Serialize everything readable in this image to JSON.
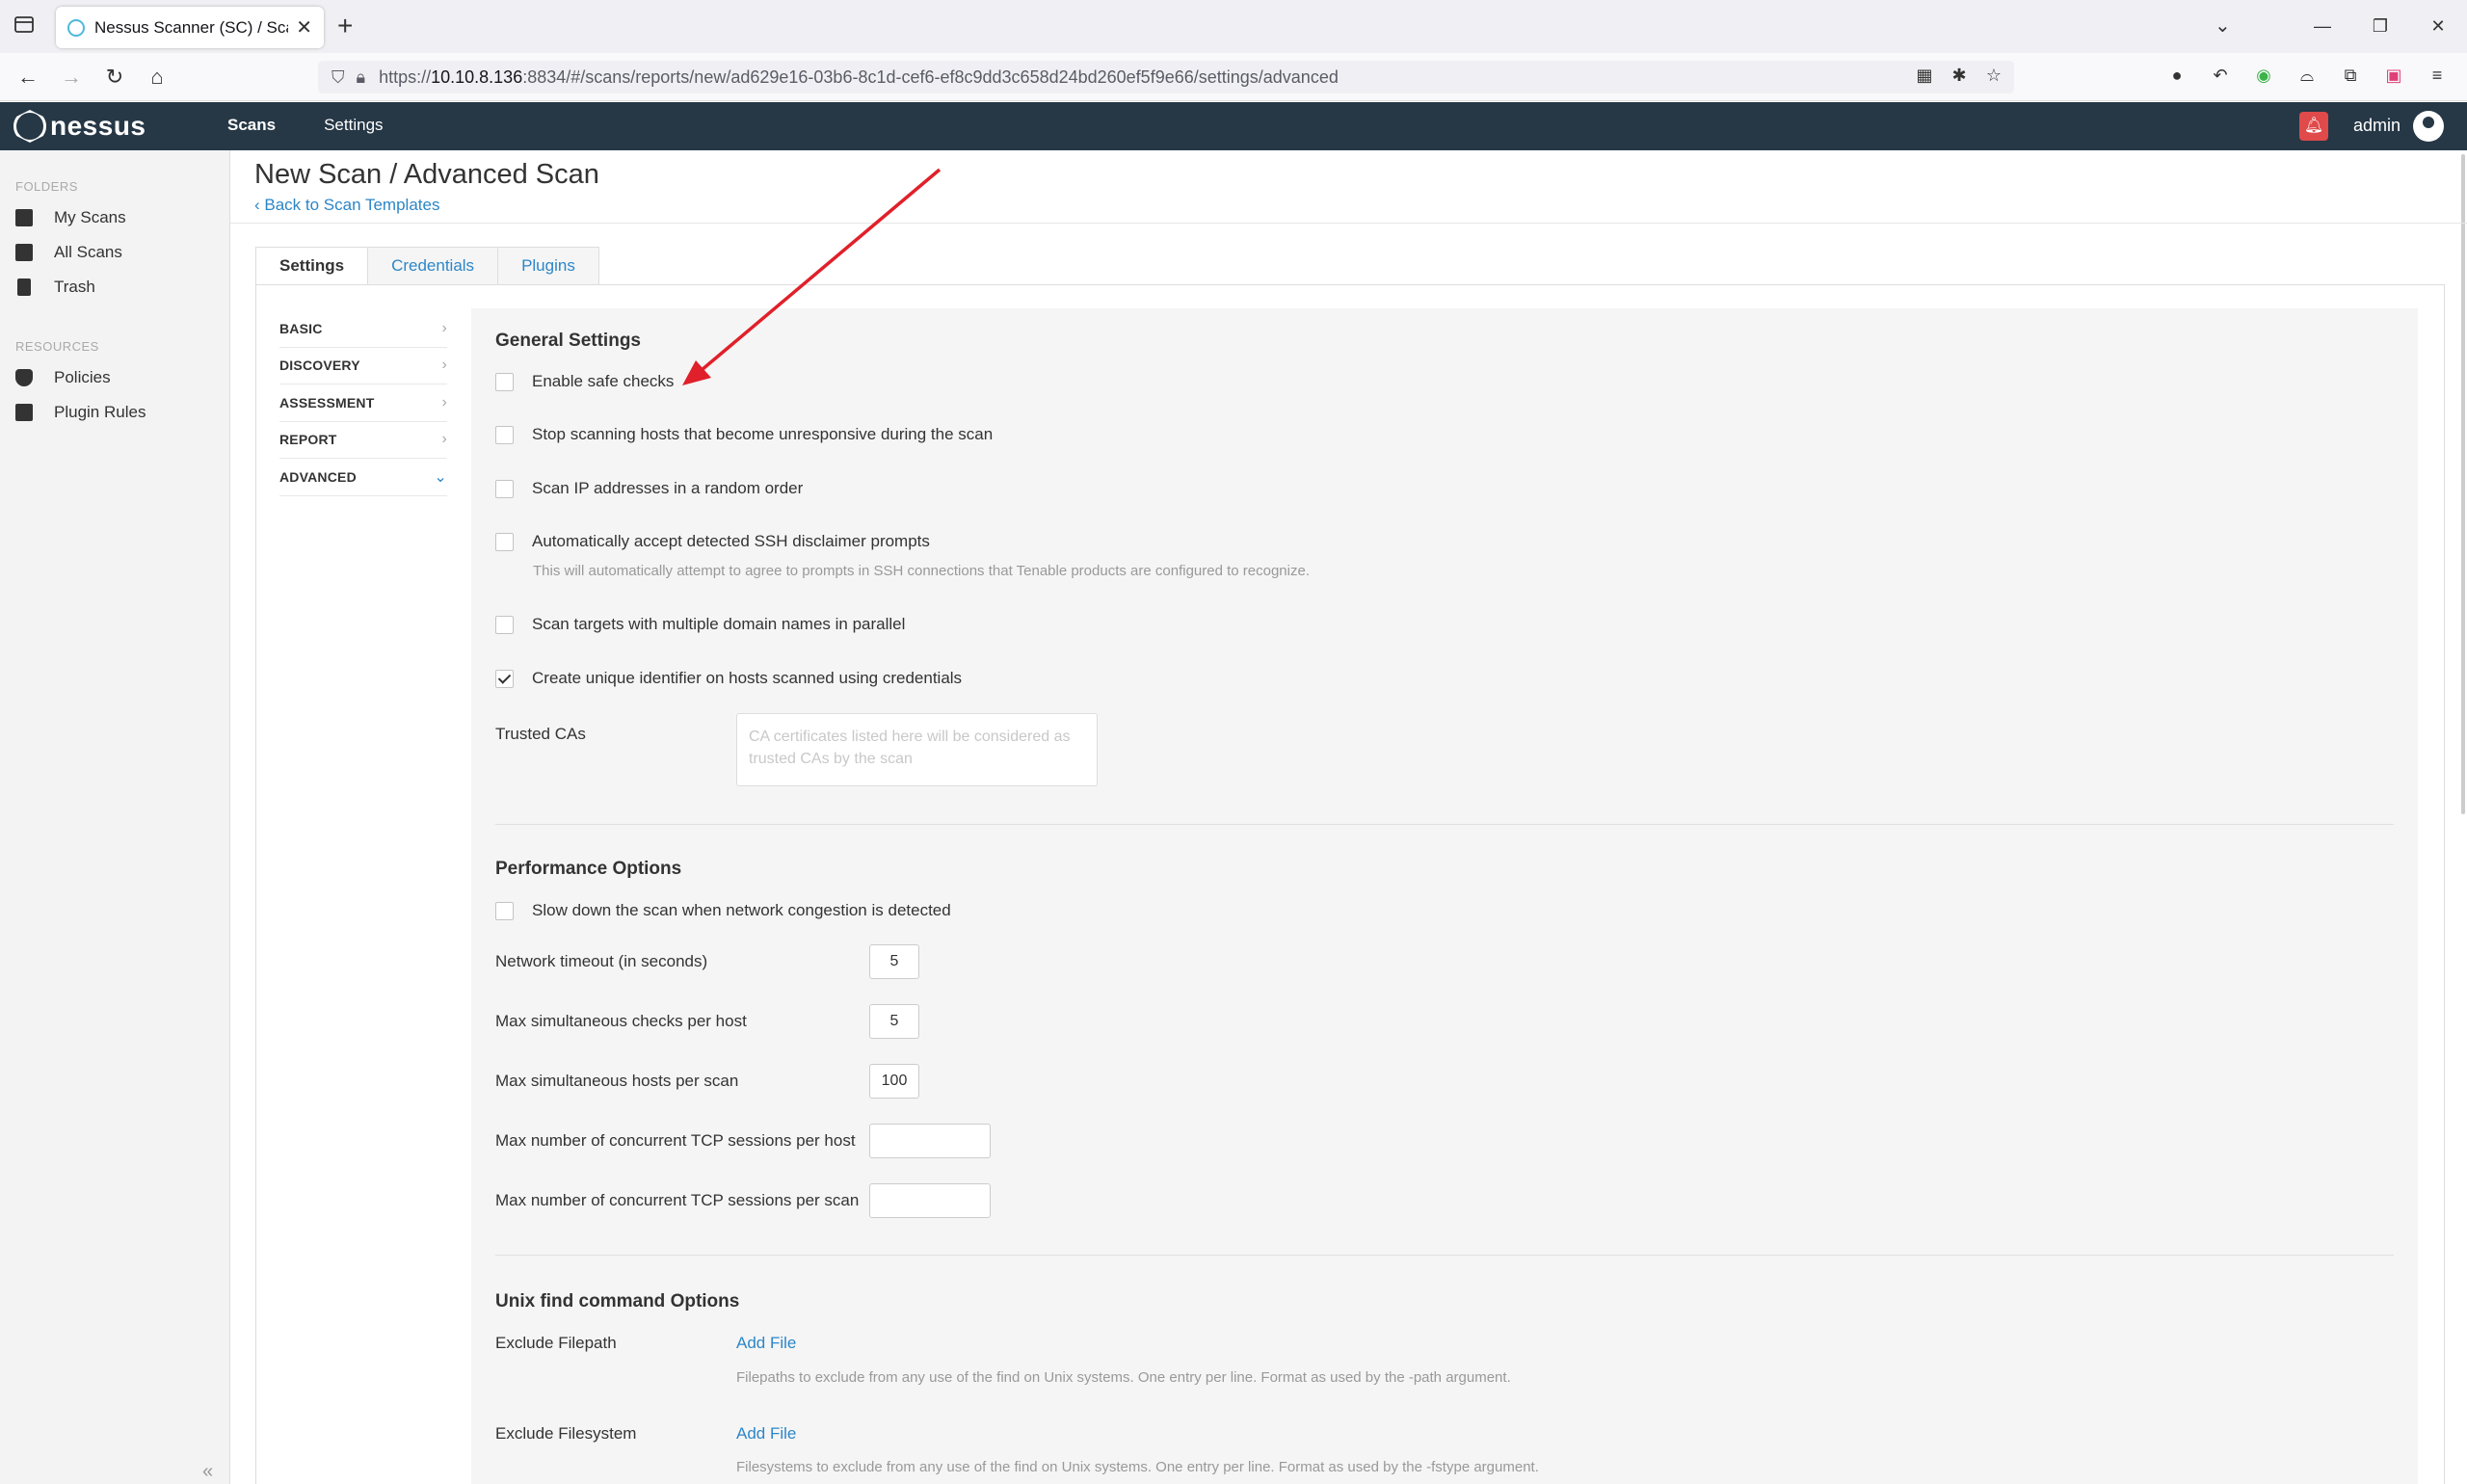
{
  "browser": {
    "tab_title": "Nessus Scanner (SC) / Scans",
    "url_prefix": "https://",
    "url_host": "10.10.8.136",
    "url_rest": ":8834/#/scans/reports/new/ad629e16-03b6-8c1d-cef6-ef8c9dd3c658d24bd260ef5f9e66/settings/advanced"
  },
  "app": {
    "logo": "nessus",
    "nav": [
      "Scans",
      "Settings"
    ],
    "user": "admin"
  },
  "sidebar": {
    "folders_heading": "FOLDERS",
    "folders": [
      "My Scans",
      "All Scans",
      "Trash"
    ],
    "resources_heading": "RESOURCES",
    "resources": [
      "Policies",
      "Plugin Rules"
    ]
  },
  "page": {
    "title": "New Scan / Advanced Scan",
    "back_link": "Back to Scan Templates",
    "tabs": [
      "Settings",
      "Credentials",
      "Plugins"
    ],
    "left_menu": [
      "BASIC",
      "DISCOVERY",
      "ASSESSMENT",
      "REPORT",
      "ADVANCED"
    ]
  },
  "general": {
    "title": "General Settings",
    "options": [
      {
        "label": "Enable safe checks",
        "checked": false
      },
      {
        "label": "Stop scanning hosts that become unresponsive during the scan",
        "checked": false
      },
      {
        "label": "Scan IP addresses in a random order",
        "checked": false
      },
      {
        "label": "Automatically accept detected SSH disclaimer prompts",
        "checked": false
      },
      {
        "label": "Scan targets with multiple domain names in parallel",
        "checked": false
      },
      {
        "label": "Create unique identifier on hosts scanned using credentials",
        "checked": true
      }
    ],
    "ssh_hint": "This will automatically attempt to agree to prompts in SSH connections that Tenable products are configured to recognize.",
    "trusted_cas_label": "Trusted CAs",
    "trusted_cas_placeholder": "CA certificates listed here will be considered as trusted CAs by the scan"
  },
  "performance": {
    "title": "Performance Options",
    "slow_down_label": "Slow down the scan when network congestion is detected",
    "fields": [
      {
        "label": "Network timeout (in seconds)",
        "value": "5"
      },
      {
        "label": "Max simultaneous checks per host",
        "value": "5"
      },
      {
        "label": "Max simultaneous hosts per scan",
        "value": "100"
      },
      {
        "label": "Max number of concurrent TCP sessions per host",
        "value": ""
      },
      {
        "label": "Max number of concurrent TCP sessions per scan",
        "value": ""
      }
    ]
  },
  "unix_find": {
    "title": "Unix find command Options",
    "exclude_filepath_label": "Exclude Filepath",
    "exclude_filepath_action": "Add File",
    "exclude_filepath_hint": "Filepaths to exclude from any use of the find on Unix systems. One entry per line. Format as used by the -path argument.",
    "exclude_filesystem_label": "Exclude Filesystem",
    "exclude_filesystem_action": "Add File",
    "exclude_filesystem_hint": "Filesystems to exclude from any use of the find on Unix systems. One entry per line. Format as used by the -fstype argument."
  },
  "colors": {
    "header_bg": "#263746",
    "link": "#2c86c8",
    "annotation_arrow": "#e0202a"
  }
}
